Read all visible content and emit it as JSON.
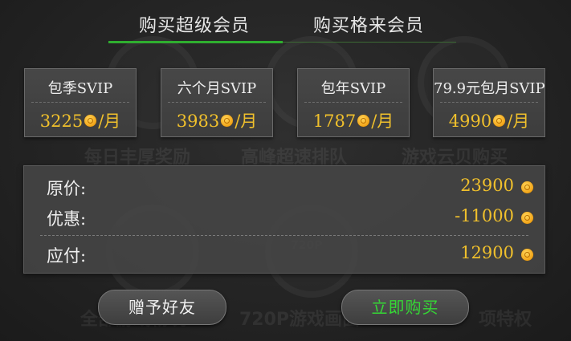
{
  "tabs": [
    {
      "label": "购买超级会员",
      "active": true
    },
    {
      "label": "购买格来会员",
      "active": false
    }
  ],
  "plans": [
    {
      "name": "包季SVIP",
      "price": "3225",
      "unit": "/月"
    },
    {
      "name": "六个月SVIP",
      "price": "3983",
      "unit": "/月"
    },
    {
      "name": "包年SVIP",
      "price": "1787",
      "unit": "/月"
    },
    {
      "name": "79.9元包月SVIP",
      "price": "4990",
      "unit": "/月"
    }
  ],
  "summary": {
    "original_label": "原价:",
    "original_value": "23900",
    "discount_label": "优惠:",
    "discount_value": "-11000",
    "payable_label": "应付:",
    "payable_value": "12900"
  },
  "buttons": {
    "gift": "赠予好友",
    "buy": "立即购买"
  },
  "background_features": [
    "每日丰厚奖励",
    "高峰超速排队",
    "游戏云贝购买",
    "全部游戏畅玩",
    "720P游戏画面",
    "项特权",
    "720P"
  ],
  "colors": {
    "accent_green": "#2fae2f",
    "buy_text": "#35d835",
    "price_gold": "#f0c02c"
  },
  "icons": {
    "coin": "coin-icon"
  }
}
